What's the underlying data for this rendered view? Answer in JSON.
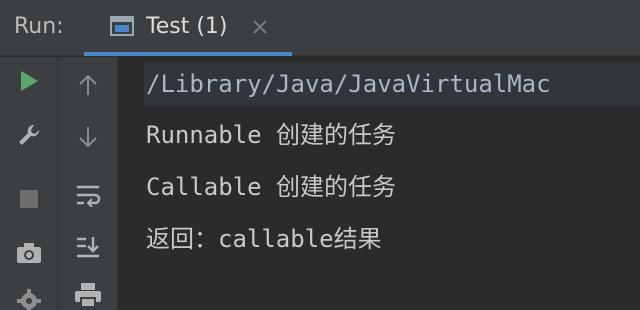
{
  "header": {
    "run_label": "Run:",
    "tab": {
      "label": "Test (1)",
      "icon": "console-window-icon",
      "close_icon": "close-icon"
    }
  },
  "toolbar_left": [
    {
      "icon": "play-icon"
    },
    {
      "icon": "wrench-icon"
    },
    {
      "icon": "stop-icon"
    },
    {
      "icon": "camera-icon"
    },
    {
      "icon": "gear-icon"
    }
  ],
  "toolbar_second": [
    {
      "icon": "arrow-up-icon"
    },
    {
      "icon": "arrow-down-icon"
    },
    {
      "icon": "soft-wrap-icon"
    },
    {
      "icon": "scroll-to-end-icon"
    },
    {
      "icon": "print-icon"
    }
  ],
  "console": {
    "lines": [
      "/Library/Java/JavaVirtualMac",
      "Runnable 创建的任务",
      "Callable 创建的任务",
      "返回：callable结果"
    ]
  },
  "colors": {
    "accent": "#4a88c7",
    "run_green": "#59a869",
    "panel": "#3c3f41",
    "background": "#2b2b2b"
  }
}
